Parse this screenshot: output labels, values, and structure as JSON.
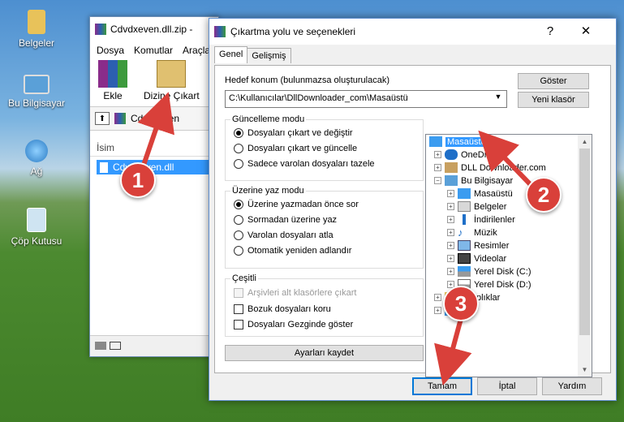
{
  "desktop": {
    "icons": [
      {
        "label": "Belgeler",
        "icon": "folder-icon"
      },
      {
        "label": "Bu Bilgisayar",
        "icon": "computer-icon"
      },
      {
        "label": "Ağ",
        "icon": "network-icon"
      },
      {
        "label": "Çöp Kutusu",
        "icon": "recycle-bin-icon"
      }
    ]
  },
  "rar": {
    "title": "Cdvdxeven.dll.zip -",
    "menu": [
      "Dosya",
      "Komutlar",
      "Araçla"
    ],
    "tools": {
      "add": "Ekle",
      "extract": "Dizine Çıkart"
    },
    "address": "Cdvdxeven",
    "col_name": "İsim",
    "file": "Cdvdxeven.dll"
  },
  "dialog": {
    "title": "Çıkartma yolu ve seçenekleri",
    "help": "?",
    "close": "✕",
    "tabs": [
      "Genel",
      "Gelişmiş"
    ],
    "dest_label": "Hedef konum (bulunmazsa oluşturulacak)",
    "dest_value": "C:\\Kullanıcılar\\DllDownloader_com\\Masaüstü",
    "show_btn": "Göster",
    "new_folder_btn": "Yeni klasör",
    "update_title": "Güncelleme modu",
    "update_opts": [
      "Dosyaları çıkart ve değiştir",
      "Dosyaları çıkart ve güncelle",
      "Sadece varolan dosyaları tazele"
    ],
    "overwrite_title": "Üzerine yaz modu",
    "overwrite_opts": [
      "Üzerine yazmadan önce sor",
      "Sormadan üzerine yaz",
      "Varolan dosyaları atla",
      "Otomatik yeniden adlandır"
    ],
    "misc_title": "Çeşitli",
    "misc_opts": [
      "Arşivleri alt klasörlere çıkart",
      "Bozuk dosyaları koru",
      "Dosyaları Gezginde göster"
    ],
    "save_btn": "Ayarları kaydet",
    "tree": [
      "Masaüstü",
      "OneDrive",
      "DLL Downloader.com",
      "Bu Bilgisayar",
      "Masaüstü",
      "Belgeler",
      "İndirilenler",
      "Müzik",
      "Resimler",
      "Videolar",
      "Yerel Disk (C:)",
      "Yerel Disk (D:)",
      "Kitaplıklar",
      ""
    ],
    "ok_btn": "Tamam",
    "cancel_btn": "İptal",
    "help_btn": "Yardım"
  },
  "callouts": [
    "1",
    "2",
    "3"
  ],
  "colors": {
    "accent": "#0078d7",
    "callout": "#d9403a",
    "selection": "#3399ff"
  }
}
